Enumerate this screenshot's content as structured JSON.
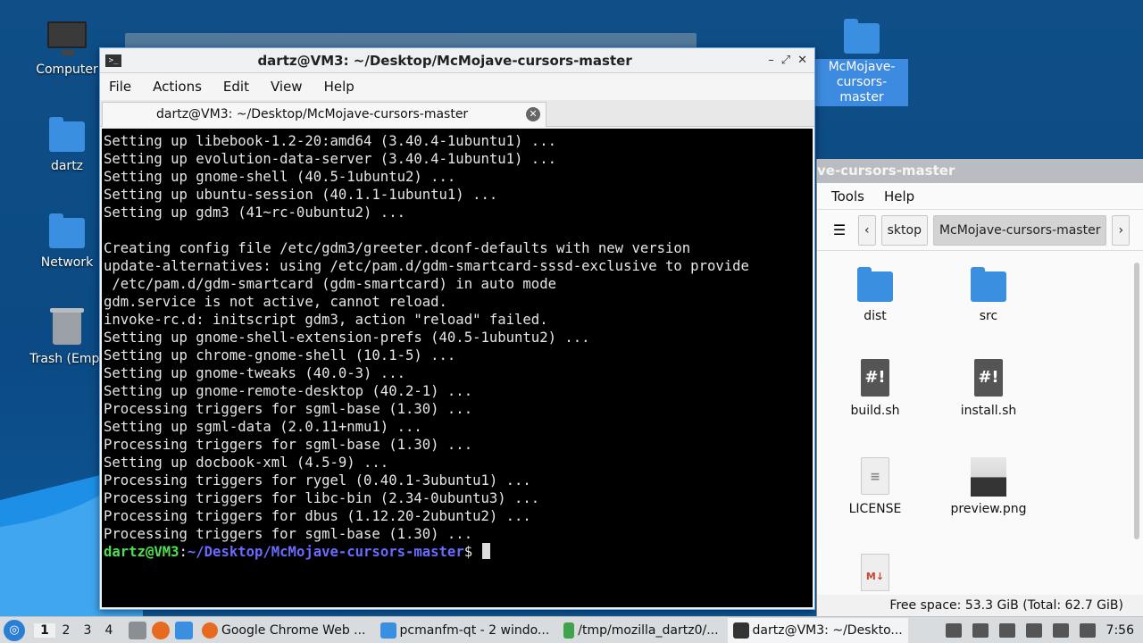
{
  "desktop": {
    "icons": [
      {
        "label": "Computer",
        "icon": "computer-icon"
      },
      {
        "label": "dartz",
        "icon": "home-folder-icon"
      },
      {
        "label": "Network",
        "icon": "network-folder-icon"
      },
      {
        "label": "Trash (Empt",
        "icon": "trash-icon"
      }
    ],
    "selected_folder": {
      "label_line1": "McMojave-",
      "label_line2": "cursors-master"
    }
  },
  "terminal": {
    "window_title": "dartz@VM3: ~/Desktop/McMojave-cursors-master",
    "menu": [
      "File",
      "Actions",
      "Edit",
      "View",
      "Help"
    ],
    "tab_label": "dartz@VM3: ~/Desktop/McMojave-cursors-master",
    "controls": {
      "minimize": "–",
      "maximize": "⤢",
      "close": "✕"
    },
    "lines": [
      "Setting up libebook-1.2-20:amd64 (3.40.4-1ubuntu1) ...",
      "Setting up evolution-data-server (3.40.4-1ubuntu1) ...",
      "Setting up gnome-shell (40.5-1ubuntu2) ...",
      "Setting up ubuntu-session (40.1.1-1ubuntu1) ...",
      "Setting up gdm3 (41~rc-0ubuntu2) ...",
      "",
      "Creating config file /etc/gdm3/greeter.dconf-defaults with new version",
      "update-alternatives: using /etc/pam.d/gdm-smartcard-sssd-exclusive to provide",
      " /etc/pam.d/gdm-smartcard (gdm-smartcard) in auto mode",
      "gdm.service is not active, cannot reload.",
      "invoke-rc.d: initscript gdm3, action \"reload\" failed.",
      "Setting up gnome-shell-extension-prefs (40.5-1ubuntu2) ...",
      "Setting up chrome-gnome-shell (10.1-5) ...",
      "Setting up gnome-tweaks (40.0-3) ...",
      "Setting up gnome-remote-desktop (40.2-1) ...",
      "Processing triggers for sgml-base (1.30) ...",
      "Setting up sgml-data (2.0.11+nmu1) ...",
      "Processing triggers for sgml-base (1.30) ...",
      "Setting up docbook-xml (4.5-9) ...",
      "Processing triggers for rygel (0.40.1-3ubuntu1) ...",
      "Processing triggers for libc-bin (2.34-0ubuntu3) ...",
      "Processing triggers for dbus (1.12.20-2ubuntu2) ...",
      "Processing triggers for sgml-base (1.30) ..."
    ],
    "prompt": {
      "user_host": "dartz@VM3",
      "sep": ":",
      "path": "~/Desktop/McMojave-cursors-master",
      "symbol": "$ "
    }
  },
  "file_manager": {
    "title_fragment": "ve-cursors-master",
    "menu": [
      "Tools",
      "Help"
    ],
    "path_prev": "sktop",
    "path_current": "McMojave-cursors-master",
    "items": [
      {
        "name": "dist",
        "icon": "folder-icon"
      },
      {
        "name": "src",
        "icon": "folder-icon"
      },
      {
        "name": "build.sh",
        "icon": "script-file-icon"
      },
      {
        "name": "install.sh",
        "icon": "script-file-icon"
      },
      {
        "name": "LICENSE",
        "icon": "text-file-icon"
      },
      {
        "name": "preview.png",
        "icon": "image-file-icon"
      },
      {
        "name": "",
        "icon": "markdown-file-icon"
      }
    ],
    "status": "Free space: 53.3 GiB (Total: 62.7 GiB)"
  },
  "taskbar": {
    "workspaces": [
      "1",
      "2",
      "3",
      "4"
    ],
    "active_workspace": "1",
    "tasks": [
      {
        "label": "Google Chrome Web ...",
        "icon": "firefox-icon",
        "color": "#e66a1f"
      },
      {
        "label": "pcmanfm-qt - 2 windo...",
        "icon": "folder-icon",
        "color": "#3a8fe0"
      },
      {
        "label": "/tmp/mozilla_dartz0/...",
        "icon": "archive-icon",
        "color": "#3fa34d"
      },
      {
        "label": "dartz@VM3: ~/Deskto...",
        "icon": "terminal-icon",
        "color": "#333333"
      }
    ],
    "clock": "7:56"
  },
  "colors": {
    "accent": "#3d8be0",
    "prompt_user": "#4fe04f",
    "prompt_path": "#6b6bff"
  }
}
